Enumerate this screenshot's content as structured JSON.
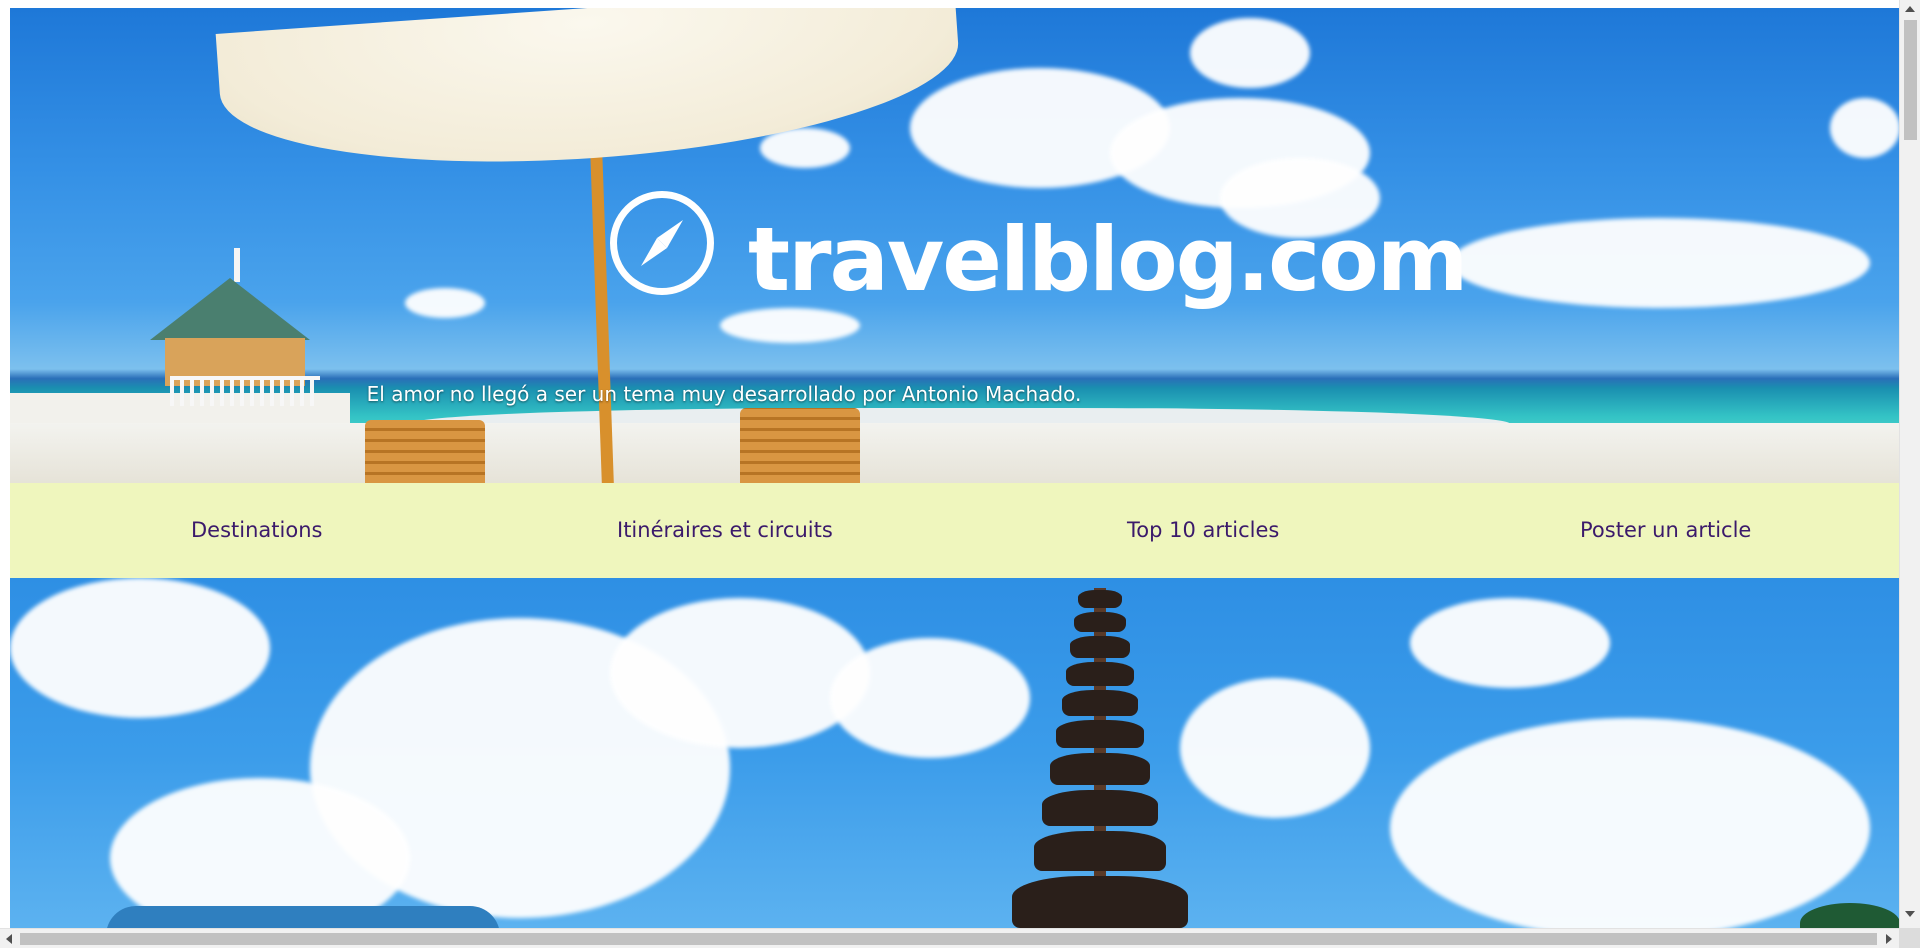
{
  "header": {
    "site_title": "travelblog.com",
    "tagline": "El amor no llegó a ser un tema muy desarrollado por Antonio Machado.",
    "logo_icon": "compass-icon"
  },
  "nav": {
    "items": [
      {
        "label": "Destinations"
      },
      {
        "label": "Itinéraires et circuits"
      },
      {
        "label": "Top 10 articles"
      },
      {
        "label": "Poster un article"
      }
    ]
  },
  "colors": {
    "nav_background": "#eff6bd",
    "nav_text": "#3b1a6b",
    "title_text": "#ffffff"
  }
}
